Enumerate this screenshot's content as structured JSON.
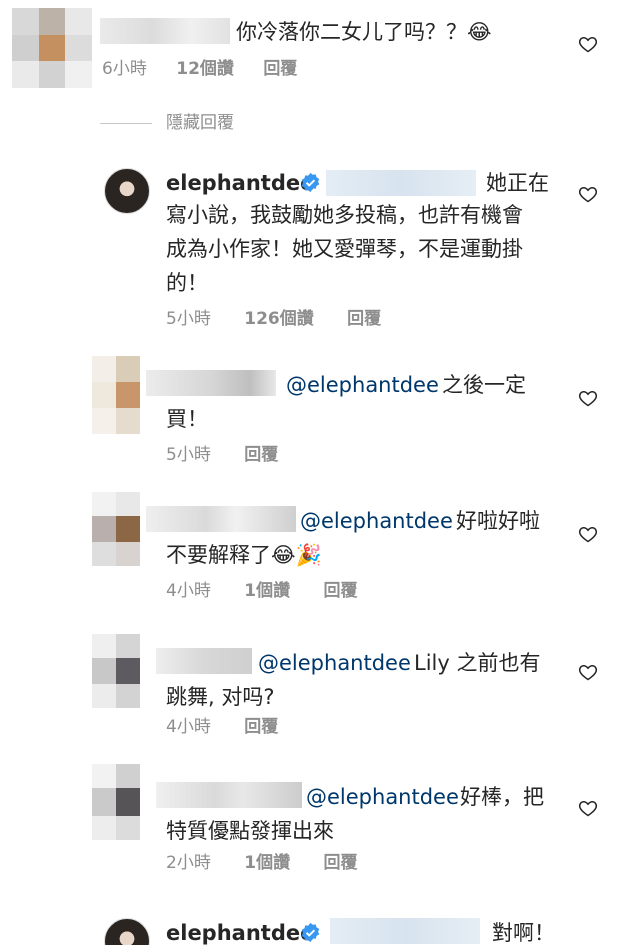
{
  "colors": {
    "text": "#262626",
    "meta": "#8e8e8e",
    "mention": "#00376b",
    "verified": "#3897f0",
    "divider": "#c7c7c7"
  },
  "comments": [
    {
      "text": "你冷落你二女儿了吗？？😂",
      "time": "6小時",
      "likes": "12個讚",
      "reply": "回覆"
    },
    {
      "username": "elephantdee",
      "text": "她正在寫小說，我鼓勵她多投稿，也許有機會成為小作家！她又愛彈琴，不是運動掛的！",
      "line1": "她正在",
      "line2": "寫小說，我鼓勵她多投稿，也許有機會",
      "line3": "成為小作家！她又愛彈琴，不是運動掛",
      "line4": "的！",
      "time": "5小時",
      "likes": "126個讚",
      "reply": "回覆"
    },
    {
      "mention": "@elephantdee",
      "line1": "之後一定",
      "line2": "買！",
      "time": "5小時",
      "reply": "回覆"
    },
    {
      "mention": "@elephantdee",
      "line1": "好啦好啦",
      "line2": "不要解释了😂🎉",
      "time": "4小時",
      "likes": "1個讚",
      "reply": "回覆"
    },
    {
      "mention": "@elephantdee",
      "line1": "Lily 之前也有",
      "line2": "跳舞, 对吗?",
      "time": "4小時",
      "reply": "回覆"
    },
    {
      "mention": "@elephantdee",
      "line1": "好棒，把",
      "line2": "特質優點發揮出來",
      "time": "2小時",
      "likes": "1個讚",
      "reply": "回覆"
    },
    {
      "username": "elephantdee",
      "line1": "對啊！"
    }
  ],
  "hidden_replies": "隱藏回覆",
  "icons": {
    "like": "heart-outline-icon",
    "verified": "verified-badge-icon"
  }
}
